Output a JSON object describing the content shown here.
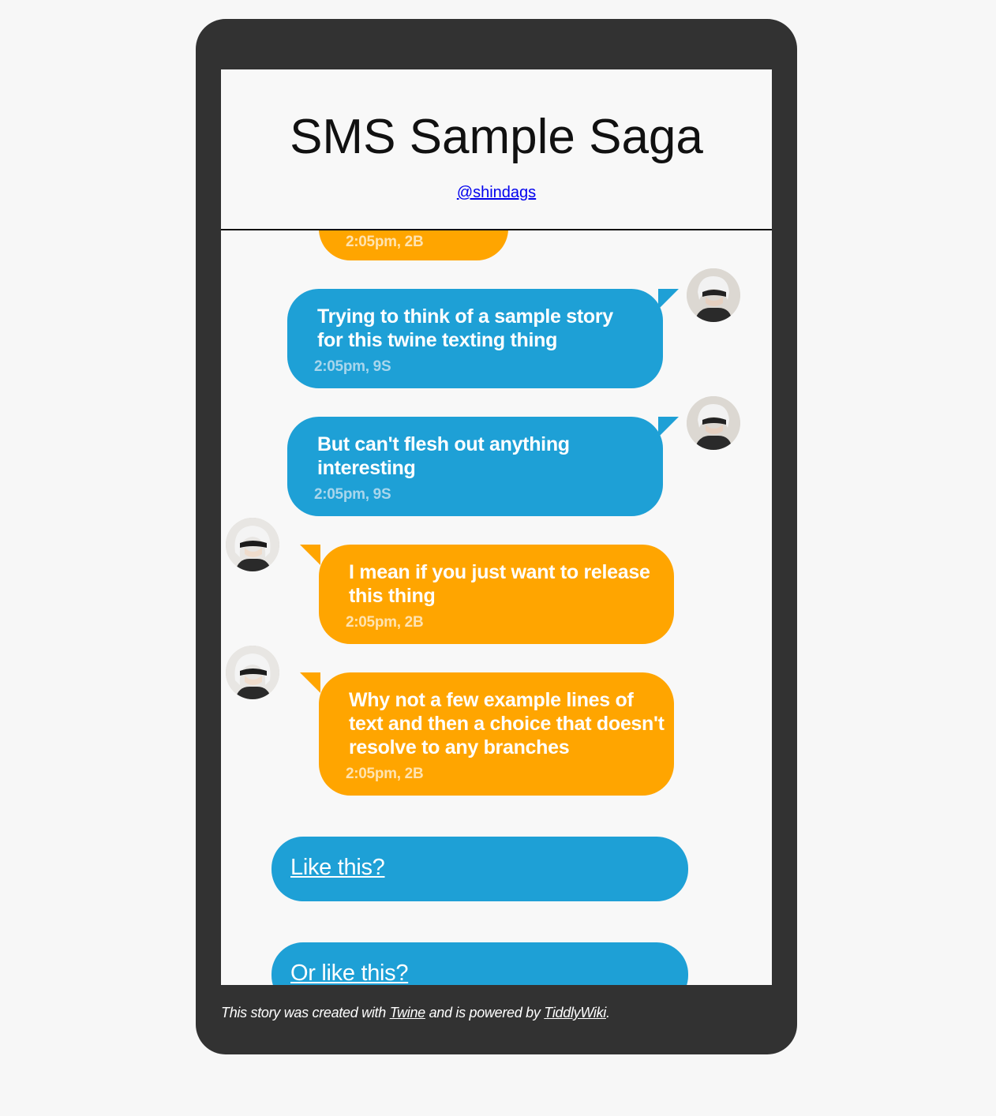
{
  "header": {
    "title": "SMS Sample Saga",
    "author_link": "@shindags"
  },
  "messages": [
    {
      "text": "",
      "meta": "2:05pm, 2B",
      "side": "left",
      "color": "orange"
    },
    {
      "text": "Trying to think of a sample story\nfor this twine texting thing",
      "meta": "2:05pm, 9S",
      "side": "right",
      "color": "blue"
    },
    {
      "text": "But can't flesh out anything\ninteresting",
      "meta": "2:05pm, 9S",
      "side": "right",
      "color": "blue"
    },
    {
      "text": "I mean if you just want to release\nthis thing",
      "meta": "2:05pm, 2B",
      "side": "left",
      "color": "orange"
    },
    {
      "text": "Why not a few example lines of\ntext and then a choice that doesn't\nresolve to any branches",
      "meta": "2:05pm, 2B",
      "side": "left",
      "color": "orange"
    }
  ],
  "choices": [
    {
      "label": "Like this?"
    },
    {
      "label": "Or like this?"
    }
  ],
  "footer": {
    "prefix": "This story was created with ",
    "link1": "Twine",
    "middle": " and is powered by ",
    "link2": "TiddlyWiki",
    "suffix": "."
  },
  "colors": {
    "phone_frame": "#323232",
    "screen_bg": "#f8f8f8",
    "blue_bubble": "#1ea0d6",
    "orange_bubble": "#ffa500"
  },
  "icons": {
    "avatar_9s": "avatar-9s-icon",
    "avatar_2b": "avatar-2b-icon"
  }
}
